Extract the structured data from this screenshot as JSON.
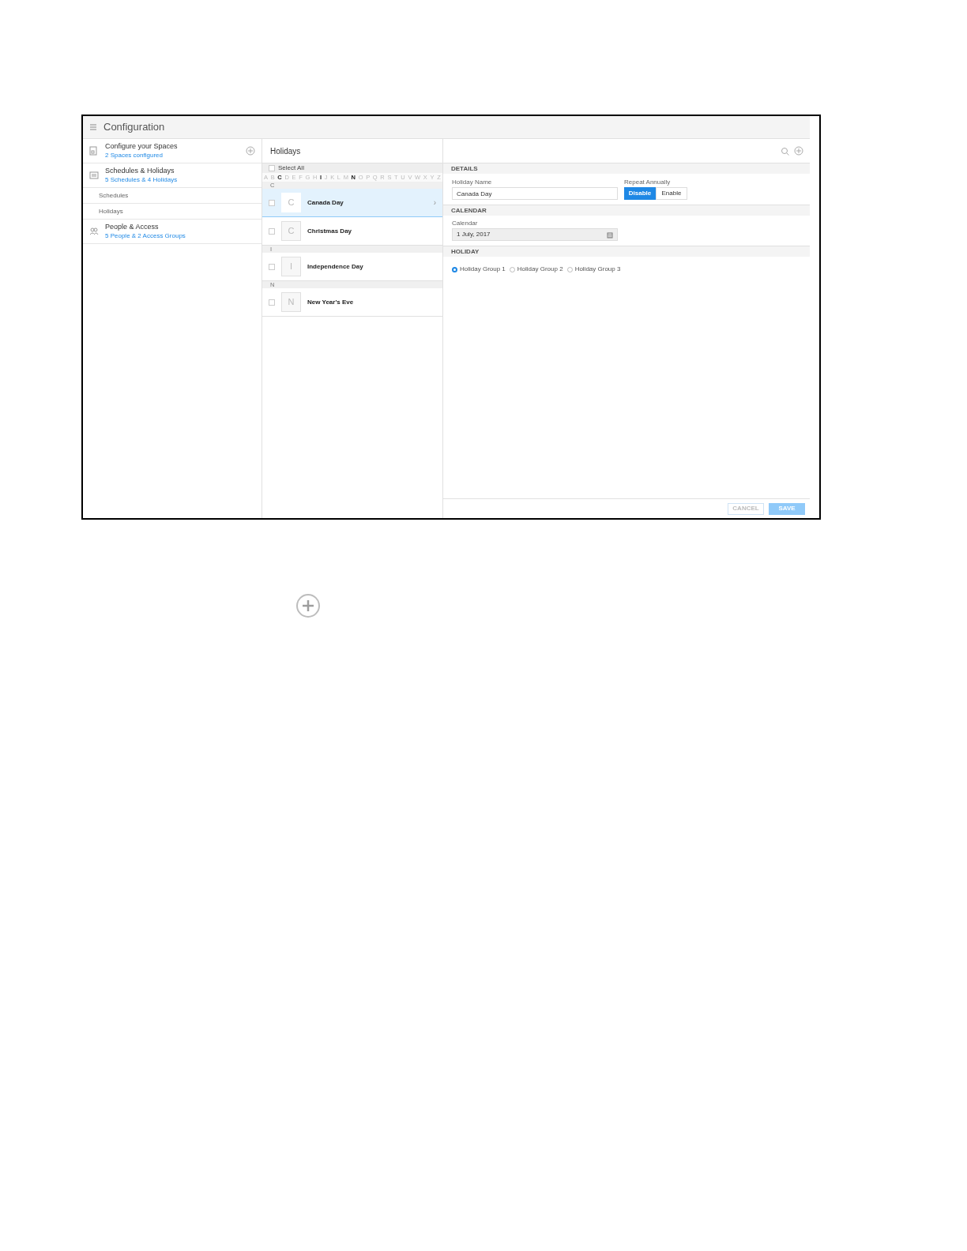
{
  "app_bar": {
    "title": "Configuration"
  },
  "sidebar": {
    "items": [
      {
        "kind": "section",
        "title": "Configure your Spaces",
        "subtitle": "2 Spaces configured",
        "add": true
      },
      {
        "kind": "section",
        "title": "Schedules & Holidays",
        "subtitle": "5 Schedules & 4 Holidays",
        "add": false
      },
      {
        "kind": "sub",
        "title": "Schedules"
      },
      {
        "kind": "sub",
        "title": "Holidays"
      },
      {
        "kind": "section",
        "title": "People & Access",
        "subtitle": "5 People & 2 Access Groups",
        "add": false
      }
    ]
  },
  "list_panel": {
    "title": "Holidays",
    "select_all": {
      "label": "Select All",
      "checked": false
    },
    "alphabet": [
      {
        "letter": "A",
        "has_items": false
      },
      {
        "letter": "B",
        "has_items": false
      },
      {
        "letter": "C",
        "has_items": true
      },
      {
        "letter": "D",
        "has_items": false
      },
      {
        "letter": "E",
        "has_items": false
      },
      {
        "letter": "F",
        "has_items": false
      },
      {
        "letter": "G",
        "has_items": false
      },
      {
        "letter": "H",
        "has_items": false
      },
      {
        "letter": "I",
        "has_items": true
      },
      {
        "letter": "J",
        "has_items": false
      },
      {
        "letter": "K",
        "has_items": false
      },
      {
        "letter": "L",
        "has_items": false
      },
      {
        "letter": "M",
        "has_items": false
      },
      {
        "letter": "N",
        "has_items": true
      },
      {
        "letter": "O",
        "has_items": false
      },
      {
        "letter": "P",
        "has_items": false
      },
      {
        "letter": "Q",
        "has_items": false
      },
      {
        "letter": "R",
        "has_items": false
      },
      {
        "letter": "S",
        "has_items": false
      },
      {
        "letter": "T",
        "has_items": false
      },
      {
        "letter": "U",
        "has_items": false
      },
      {
        "letter": "V",
        "has_items": false
      },
      {
        "letter": "W",
        "has_items": false
      },
      {
        "letter": "X",
        "has_items": false
      },
      {
        "letter": "Y",
        "has_items": false
      },
      {
        "letter": "Z",
        "has_items": false
      }
    ],
    "groups": [
      {
        "letter": "C",
        "items": [
          {
            "initial": "C",
            "name": "Canada Day",
            "selected": true,
            "checked": false,
            "chevron": "›"
          },
          {
            "initial": "C",
            "name": "Christmas Day",
            "selected": false,
            "checked": false
          }
        ]
      },
      {
        "letter": "I",
        "items": [
          {
            "initial": "I",
            "name": "Independence Day",
            "selected": false,
            "checked": false
          }
        ]
      },
      {
        "letter": "N",
        "items": [
          {
            "initial": "N",
            "name": "New Year's Eve",
            "selected": false,
            "checked": false
          }
        ]
      }
    ]
  },
  "details": {
    "sections": [
      {
        "kind": "details",
        "heading": "DETAILS",
        "name_label": "Holiday Name",
        "name_value": "Canada Day",
        "repeat_label": "Repeat Annually",
        "options": [
          {
            "label": "Disable",
            "selected": true
          },
          {
            "label": "Enable",
            "selected": false
          }
        ]
      },
      {
        "kind": "calendar",
        "heading": "CALENDAR",
        "label": "Calendar",
        "value": "1 July, 2017"
      },
      {
        "kind": "holiday",
        "heading": "HOLIDAY",
        "options": [
          {
            "label": "Holiday Group 1",
            "selected": true
          },
          {
            "label": "Holiday Group 2",
            "selected": false
          },
          {
            "label": "Holiday Group 3",
            "selected": false
          }
        ]
      }
    ],
    "buttons": [
      {
        "kind": "secondary",
        "label": "CANCEL"
      },
      {
        "kind": "primary",
        "label": "SAVE"
      }
    ]
  }
}
